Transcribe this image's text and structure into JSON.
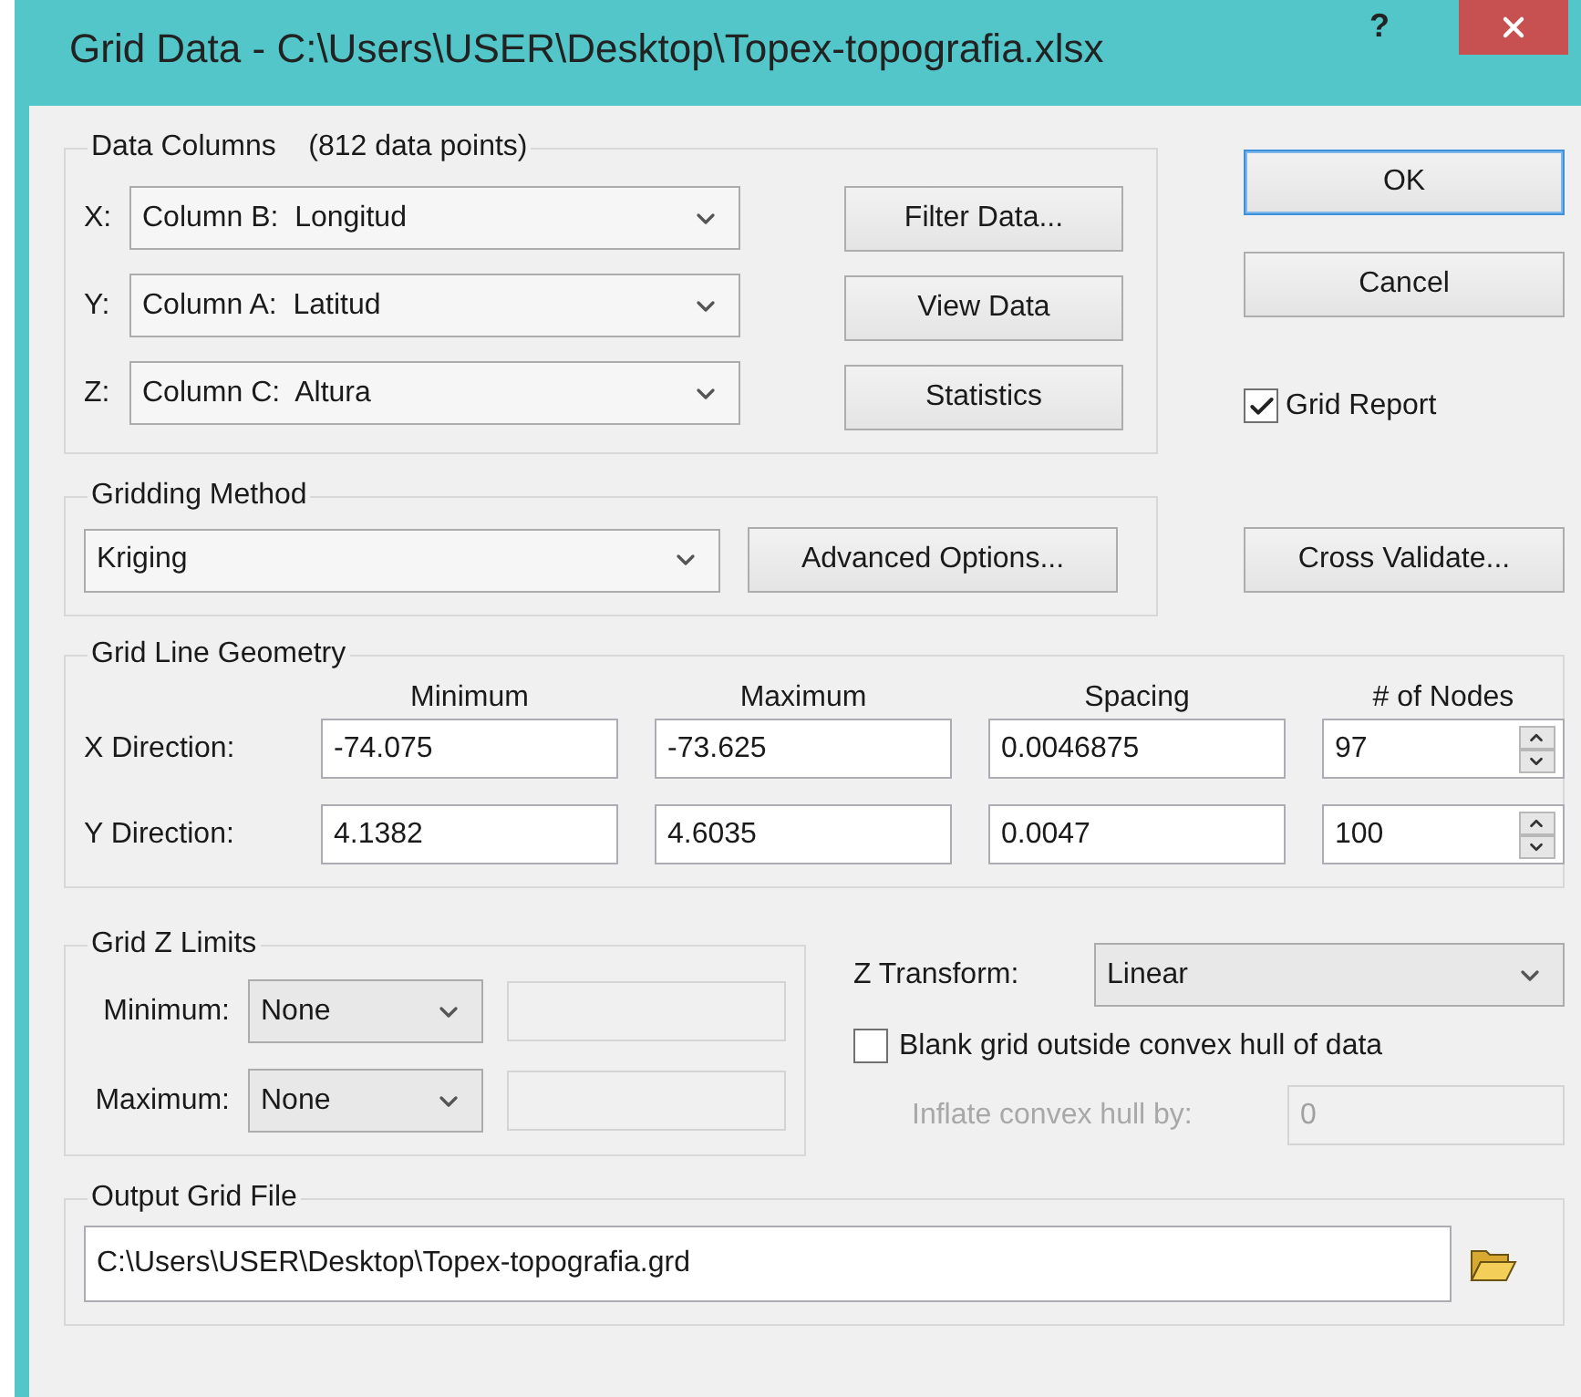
{
  "window": {
    "title": "Grid Data - C:\\Users\\USER\\Desktop\\Topex-topografia.xlsx",
    "help": "?"
  },
  "data_columns": {
    "title": "Data Columns",
    "count": "(812 data points)",
    "columns": [
      {
        "axis": "X:",
        "value": "Column B:  Longitud"
      },
      {
        "axis": "Y:",
        "value": "Column A:  Latitud"
      },
      {
        "axis": "Z:",
        "value": "Column C:  Altura"
      }
    ],
    "buttons": [
      "Filter Data...",
      "View Data",
      "Statistics"
    ]
  },
  "dialog_buttons": [
    {
      "label": "OK",
      "default": true
    },
    {
      "label": "Cancel",
      "default": false
    }
  ],
  "grid_report": {
    "label": "Grid Report",
    "checked": true
  },
  "gridding_method": {
    "title": "Gridding Method",
    "value": "Kriging",
    "advanced": "Advanced Options..."
  },
  "cross_validate": "Cross Validate...",
  "geometry": {
    "title": "Grid Line Geometry",
    "headers": [
      "Minimum",
      "Maximum",
      "Spacing",
      "# of Nodes"
    ],
    "rows": [
      {
        "label": "X Direction:",
        "minimum": "-74.075",
        "maximum": "-73.625",
        "spacing": "0.0046875",
        "nodes": "97"
      },
      {
        "label": "Y Direction:",
        "minimum": "4.1382",
        "maximum": "4.6035",
        "spacing": "0.0047",
        "nodes": "100"
      }
    ]
  },
  "z_limits": {
    "title": "Grid Z Limits",
    "rows": [
      {
        "label": "Minimum:",
        "mode": "None",
        "value_disabled": true
      },
      {
        "label": "Maximum:",
        "mode": "None",
        "value_disabled": true
      }
    ]
  },
  "z_transform": {
    "label": "Z Transform:",
    "value": "Linear"
  },
  "blank_outside_hull": {
    "label": "Blank grid outside convex hull of data",
    "checked": false
  },
  "inflate": {
    "label": "Inflate convex hull by:",
    "value": "0",
    "disabled": true
  },
  "output": {
    "title": "Output Grid File",
    "value": "C:\\Users\\USER\\Desktop\\Topex-topografia.grd"
  }
}
